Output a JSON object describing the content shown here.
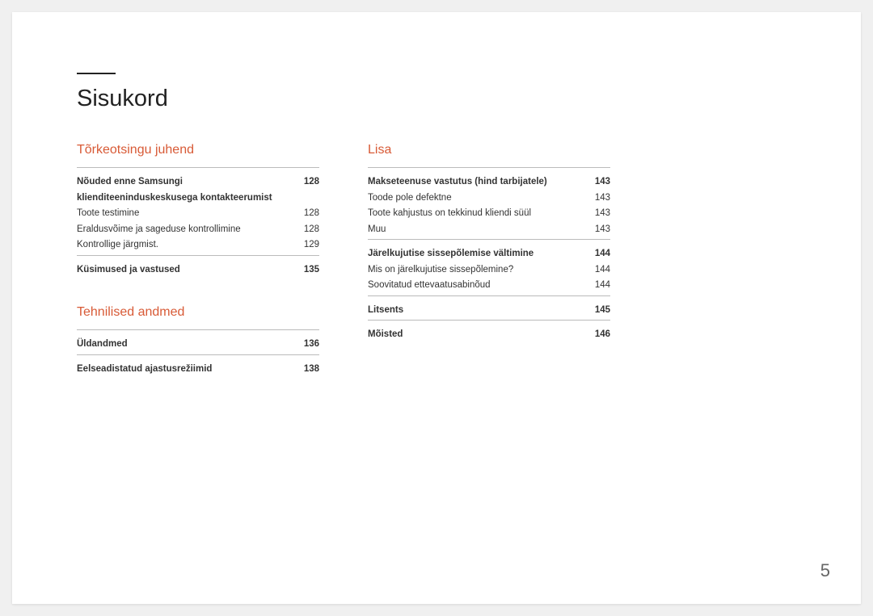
{
  "title": "Sisukord",
  "pageNumber": "5",
  "left": {
    "sections": [
      {
        "heading": "Tõrkeotsingu juhend",
        "groups": [
          [
            {
              "label": "Nõuded enne Samsungi klienditeeninduskeskusega kontakteerumist",
              "page": "128",
              "bold": true
            },
            {
              "label": "Toote testimine",
              "page": "128",
              "bold": false
            },
            {
              "label": "Eraldusvõime ja sageduse kontrollimine",
              "page": "128",
              "bold": false
            },
            {
              "label": "Kontrollige järgmist.",
              "page": "129",
              "bold": false
            }
          ],
          [
            {
              "label": "Küsimused ja vastused",
              "page": "135",
              "bold": true
            }
          ]
        ]
      },
      {
        "heading": "Tehnilised andmed",
        "groups": [
          [
            {
              "label": "Üldandmed",
              "page": "136",
              "bold": true
            }
          ],
          [
            {
              "label": "Eelseadistatud ajastusrežiimid",
              "page": "138",
              "bold": true
            }
          ]
        ]
      }
    ]
  },
  "right": {
    "sections": [
      {
        "heading": "Lisa",
        "groups": [
          [
            {
              "label": "Makseteenuse vastutus (hind tarbijatele)",
              "page": "143",
              "bold": true
            },
            {
              "label": "Toode pole defektne",
              "page": "143",
              "bold": false
            },
            {
              "label": "Toote kahjustus on tekkinud kliendi süül",
              "page": "143",
              "bold": false
            },
            {
              "label": "Muu",
              "page": "143",
              "bold": false
            }
          ],
          [
            {
              "label": "Järelkujutise sissepõlemise vältimine",
              "page": "144",
              "bold": true
            },
            {
              "label": "Mis on järelkujutise sissepõlemine?",
              "page": "144",
              "bold": false
            },
            {
              "label": "Soovitatud ettevaatusabinõud",
              "page": "144",
              "bold": false
            }
          ],
          [
            {
              "label": "Litsents",
              "page": "145",
              "bold": true
            }
          ],
          [
            {
              "label": "Mõisted",
              "page": "146",
              "bold": true
            }
          ]
        ]
      }
    ]
  }
}
